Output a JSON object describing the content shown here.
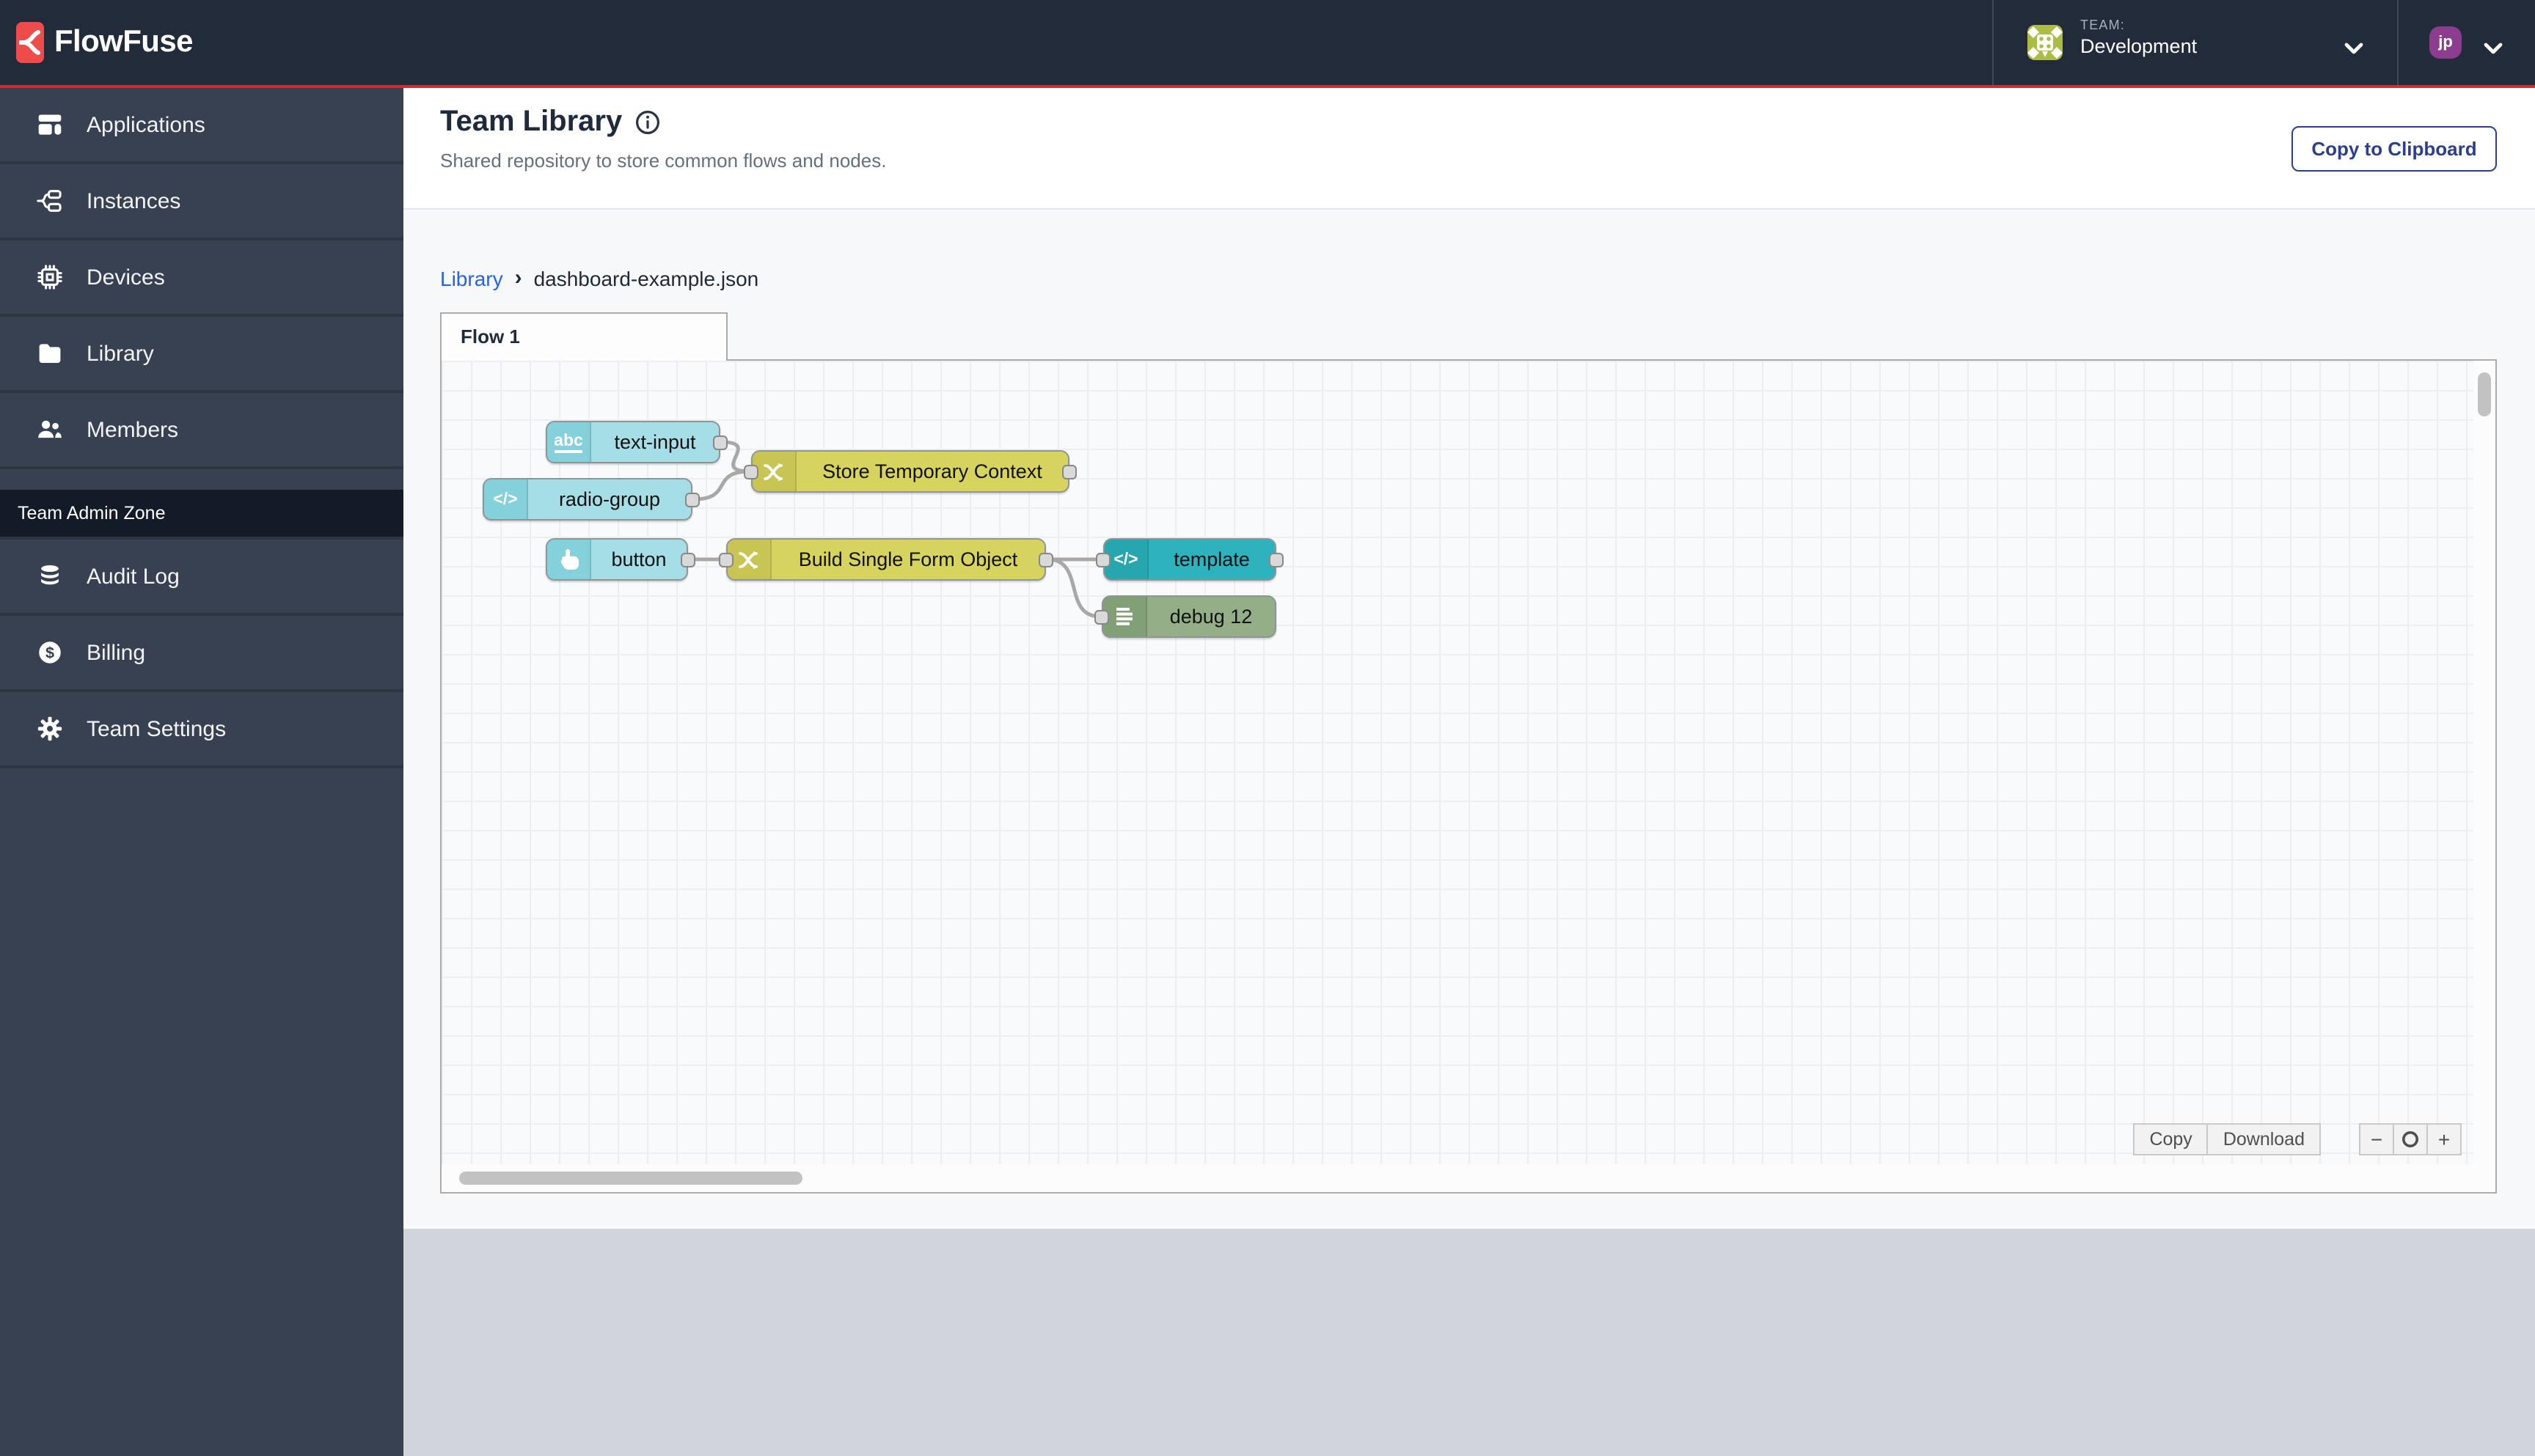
{
  "header": {
    "brand": "FlowFuse",
    "team_label": "TEAM:",
    "team_name": "Development",
    "user_initials": "jp"
  },
  "sidebar": {
    "items": [
      {
        "label": "Applications",
        "icon": "applications-icon"
      },
      {
        "label": "Instances",
        "icon": "instances-icon"
      },
      {
        "label": "Devices",
        "icon": "devices-icon"
      },
      {
        "label": "Library",
        "icon": "library-icon"
      },
      {
        "label": "Members",
        "icon": "members-icon"
      }
    ],
    "admin_zone_label": "Team Admin Zone",
    "admin_items": [
      {
        "label": "Audit Log",
        "icon": "audit-log-icon"
      },
      {
        "label": "Billing",
        "icon": "billing-icon"
      },
      {
        "label": "Team Settings",
        "icon": "settings-icon"
      }
    ]
  },
  "page": {
    "title": "Team Library",
    "subtitle": "Shared repository to store common flows and nodes.",
    "copy_button": "Copy to Clipboard"
  },
  "breadcrumb": {
    "parent": "Library",
    "separator": "›",
    "current": "dashboard-example.json"
  },
  "flow": {
    "tab_label": "Flow 1",
    "glyphs": {
      "abc": "abc",
      "code": "</>"
    },
    "nodes": [
      {
        "label": "text-input",
        "type": "ui-widget",
        "icon": "abc-icon"
      },
      {
        "label": "radio-group",
        "type": "ui-widget",
        "icon": "code-icon"
      },
      {
        "label": "Store Temporary Context",
        "type": "change",
        "icon": "shuffle-icon"
      },
      {
        "label": "button",
        "type": "ui-widget",
        "icon": "pointer-icon"
      },
      {
        "label": "Build Single Form Object",
        "type": "change",
        "icon": "shuffle-icon"
      },
      {
        "label": "template",
        "type": "template",
        "icon": "code-icon"
      },
      {
        "label": "debug 12",
        "type": "debug",
        "icon": "list-icon"
      }
    ],
    "controls": {
      "copy": "Copy",
      "download": "Download",
      "zoom_out": "−",
      "zoom_in": "+"
    }
  },
  "colors": {
    "accent_red": "#D02E2E",
    "logo_red": "#EE4B4B",
    "header_bg": "#222B3A",
    "sidebar_bg": "#384151",
    "admin_band_bg": "#131A28",
    "link_blue": "#2563EB",
    "button_blue": "#2B3E8F",
    "node_ui": "#A6DEE7",
    "node_change": "#D7D35F",
    "node_template": "#2DB3BD",
    "node_debug": "#94AE88",
    "wire_gray": "#A8A8A8",
    "page_gray": "#D1D4DB"
  }
}
